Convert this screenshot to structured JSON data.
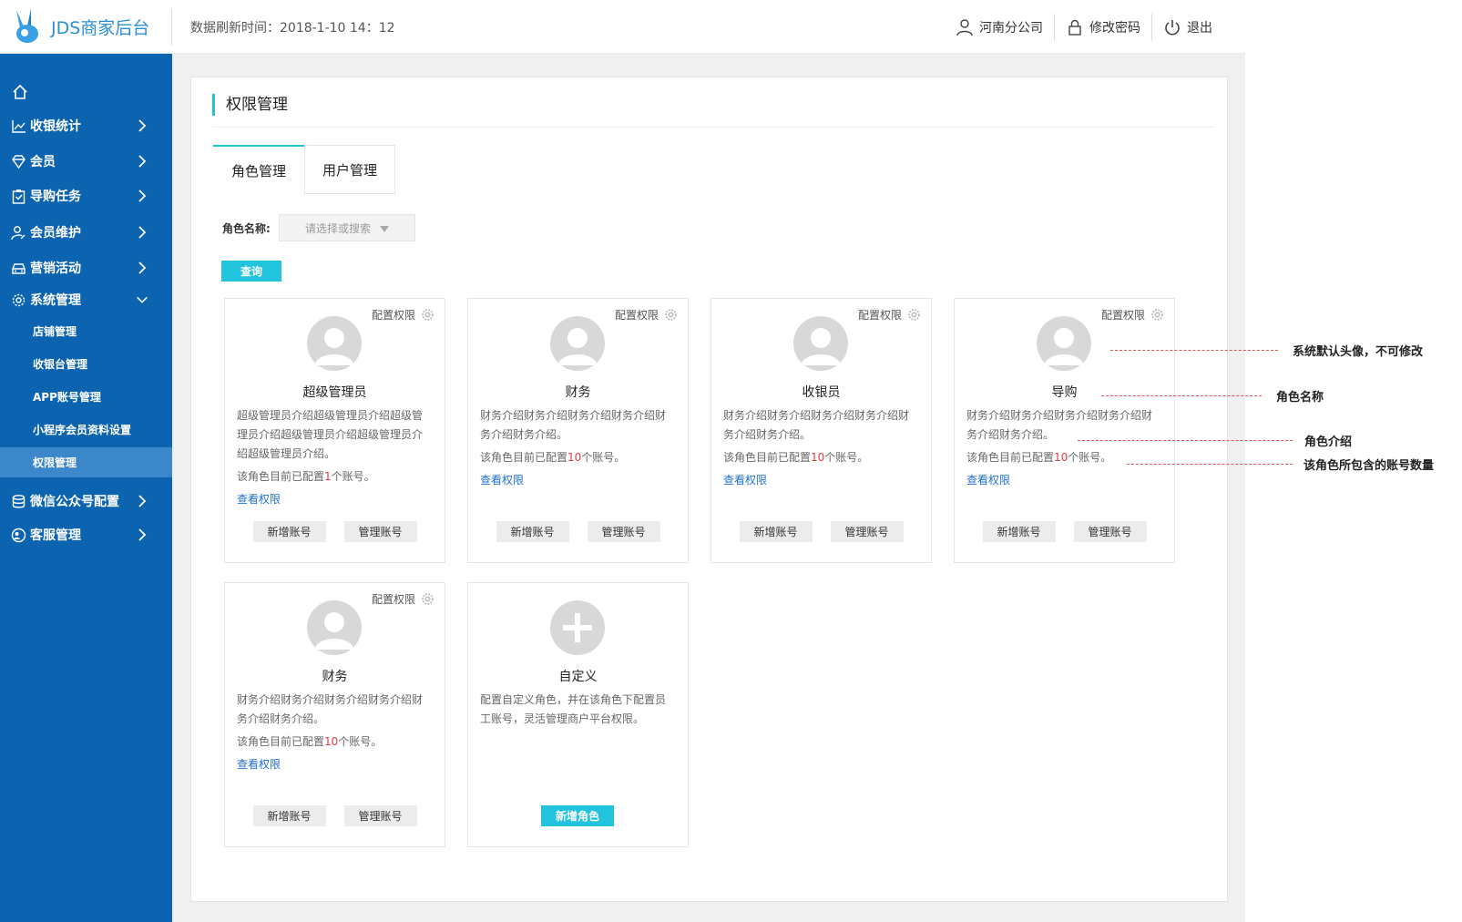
{
  "app": {
    "title": "JDS商家后台",
    "refresh_text": "数据刷新时间：2018-1-10 14：12"
  },
  "header": {
    "company": "河南分公司",
    "change_password": "修改密码",
    "logout": "退出"
  },
  "sidebar": {
    "items": [
      {
        "label": "收银统计"
      },
      {
        "label": "会员"
      },
      {
        "label": "导购任务"
      },
      {
        "label": "会员维护"
      },
      {
        "label": "营销活动"
      },
      {
        "label": "系统管理"
      },
      {
        "label": "微信公众号配置"
      },
      {
        "label": "客服管理"
      }
    ],
    "sub_items": [
      {
        "label": "店铺管理"
      },
      {
        "label": "收银台管理"
      },
      {
        "label": "APP账号管理"
      },
      {
        "label": "小程序会员资料设置"
      },
      {
        "label": "权限管理"
      }
    ]
  },
  "page": {
    "title": "权限管理",
    "tabs": [
      {
        "label": "角色管理"
      },
      {
        "label": "用户管理"
      }
    ],
    "filter_label": "角色名称:",
    "select_placeholder": "请选择或搜索",
    "query_button": "查询"
  },
  "card_common": {
    "config_label": "配置权限",
    "view_link": "查看权限",
    "add_account": "新增账号",
    "manage_account": "管理账号",
    "count_prefix": "该角色目前已配置",
    "count_suffix": "个账号。"
  },
  "cards": [
    {
      "name": "超级管理员",
      "desc": "超级管理员介绍超级管理员介绍超级管理员介绍超级管理员介绍超级管理员介绍超级管理员介绍。",
      "count": "1"
    },
    {
      "name": "财务",
      "desc": "财务介绍财务介绍财务介绍财务介绍财务介绍财务介绍。",
      "count": "10"
    },
    {
      "name": "收银员",
      "desc": "财务介绍财务介绍财务介绍财务介绍财务介绍财务介绍。",
      "count": "10"
    },
    {
      "name": "导购",
      "desc": "财务介绍财务介绍财务介绍财务介绍财务介绍财务介绍。",
      "count": "10"
    },
    {
      "name": "财务",
      "desc": "财务介绍财务介绍财务介绍财务介绍财务介绍财务介绍。",
      "count": "10"
    }
  ],
  "custom_card": {
    "name": "自定义",
    "desc": "配置自定义角色，并在该角色下配置员工账号，灵活管理商户平台权限。",
    "button": "新增角色"
  },
  "annotations": [
    {
      "text": "系统默认头像，不可修改"
    },
    {
      "text": "角色名称"
    },
    {
      "text": "角色介绍"
    },
    {
      "text": "该角色所包含的账号数量"
    }
  ],
  "colors": {
    "sidebar": "#0c64b0",
    "accent": "#22c3dd",
    "link": "#1f6fd1",
    "count": "#e53b3b"
  }
}
